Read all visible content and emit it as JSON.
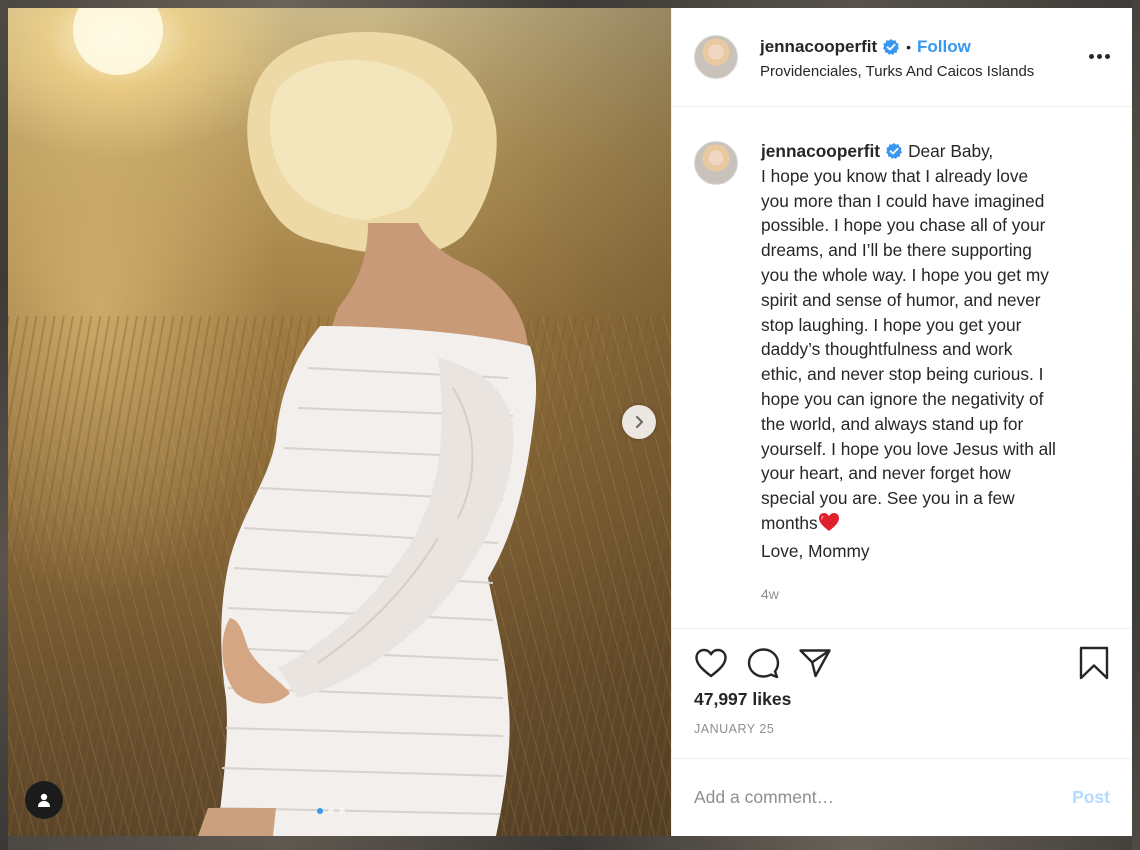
{
  "post": {
    "username": "jennacooperfit",
    "verified": true,
    "follow_label": "Follow",
    "separator": "•",
    "location": "Providenciales, Turks And Caicos Islands",
    "caption_lines": [
      "Dear Baby,",
      "I hope you know that I already love",
      "you more than I could have imagined",
      "possible. I hope you chase all of your",
      "dreams, and I’ll be there supporting",
      "you the whole way. I hope you get my",
      "spirit and sense of humor, and never",
      "stop laughing. I hope you get your",
      "daddy’s thoughtfulness and work",
      "ethic, and never stop being curious. I",
      "hope you can ignore the negativity of",
      "the world, and always stand up for",
      "yourself. I hope you love Jesus with all",
      "your heart, and never forget how",
      "special you are. See you in a few",
      "months",
      "Love, Mommy"
    ],
    "time_ago": "4w",
    "likes": "47,997 likes",
    "date": "JANUARY 25",
    "comment_placeholder": "Add a comment…",
    "post_label": "Post"
  },
  "carousel": {
    "slide_count": 3,
    "active_slide": 1
  },
  "icons": {
    "verified": "verified-badge-icon",
    "more": "more-options-icon",
    "like": "heart-icon",
    "comment": "comment-icon",
    "share": "share-icon",
    "save": "bookmark-icon",
    "next": "chevron-right-icon",
    "tag": "user-tag-icon"
  },
  "colors": {
    "accent": "#3897f0",
    "post_disabled": "#b3dbff",
    "muted": "#8e8e8e",
    "text": "#262626"
  }
}
